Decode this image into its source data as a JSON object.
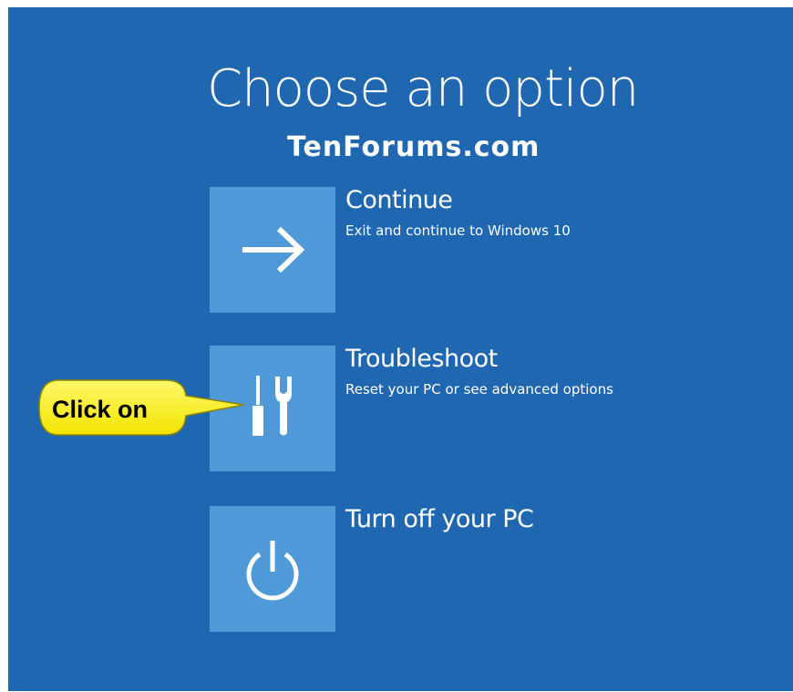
{
  "screen": {
    "title": "Choose an option",
    "watermark": "TenForums.com",
    "background_color": "#2067b2",
    "tile_color": "#5099d8"
  },
  "options": [
    {
      "title": "Continue",
      "description": "Exit and continue to Windows 10",
      "icon": "arrow-right-icon"
    },
    {
      "title": "Troubleshoot",
      "description": "Reset your PC or see advanced options",
      "icon": "tools-icon"
    },
    {
      "title": "Turn off your PC",
      "description": "",
      "icon": "power-icon"
    }
  ],
  "callout": {
    "label": "Click on",
    "color": "#fff200",
    "target": "Troubleshoot"
  }
}
